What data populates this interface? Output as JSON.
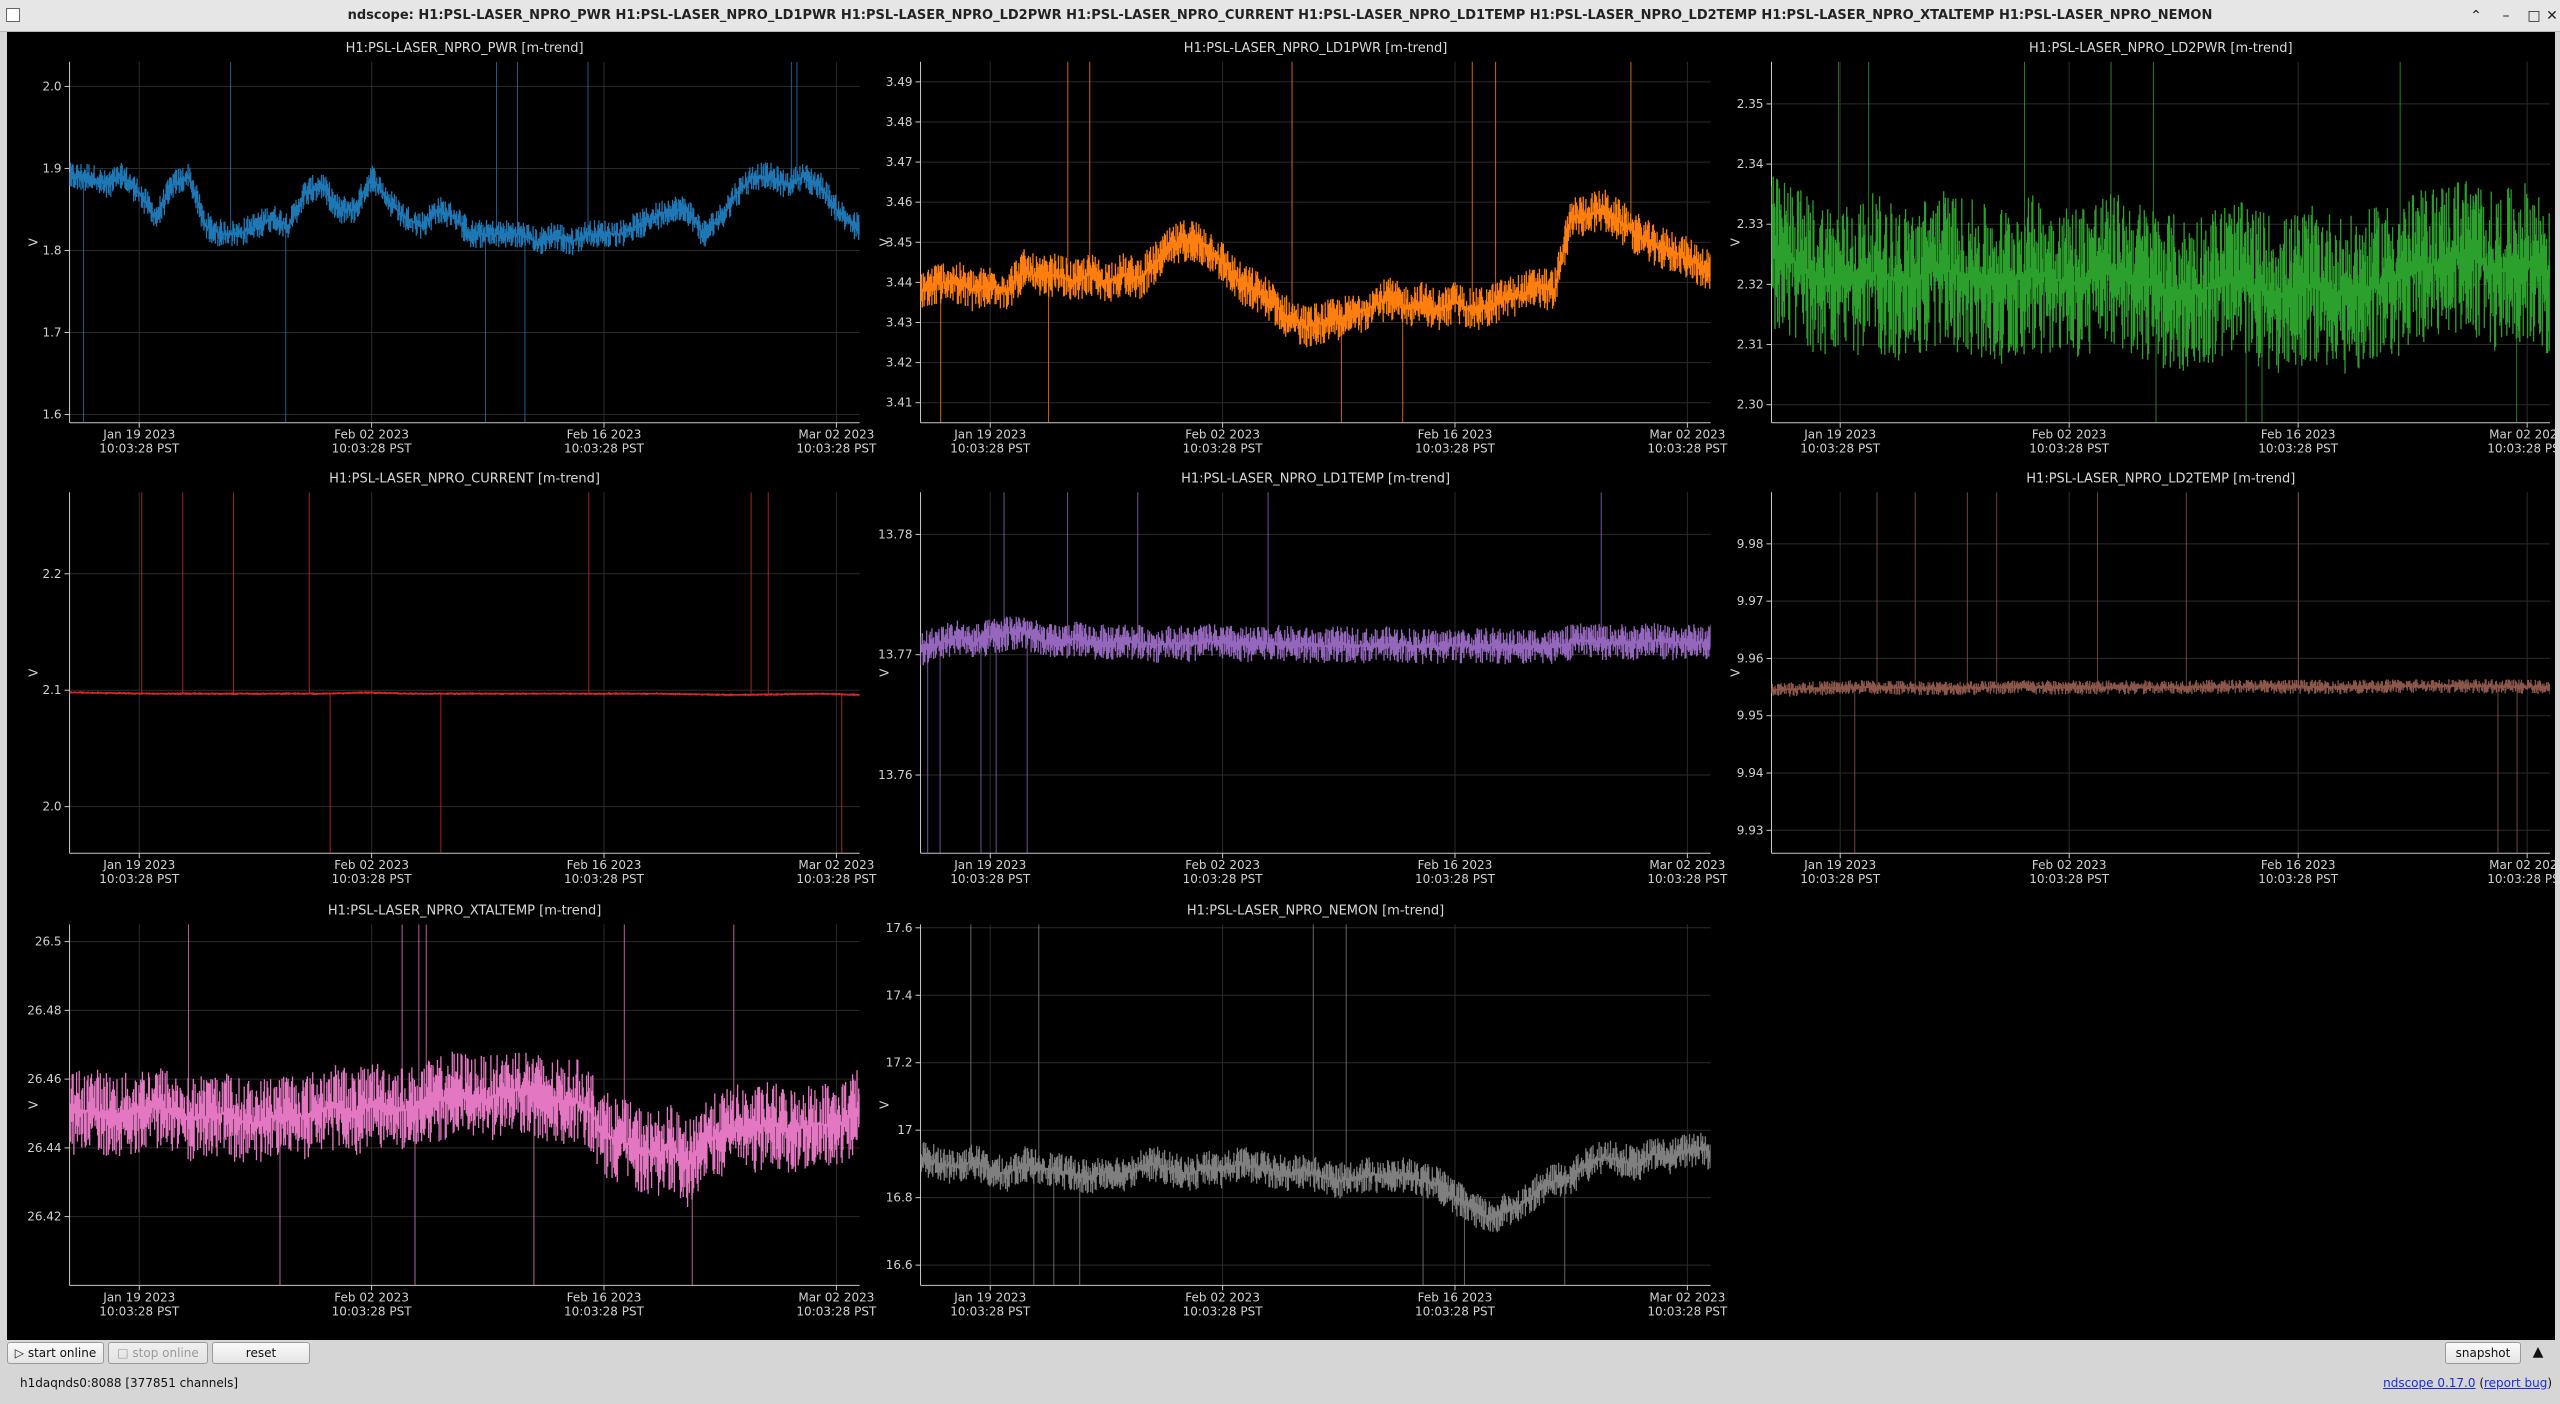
{
  "window": {
    "title": "ndscope: H1:PSL-LASER_NPRO_PWR H1:PSL-LASER_NPRO_LD1PWR H1:PSL-LASER_NPRO_LD2PWR H1:PSL-LASER_NPRO_CURRENT H1:PSL-LASER_NPRO_LD1TEMP H1:PSL-LASER_NPRO_LD2TEMP H1:PSL-LASER_NPRO_XTALTEMP H1:PSL-LASER_NPRO_NEMON"
  },
  "time_axis": {
    "ticks": [
      {
        "date": "Jan 19 2023",
        "time": "10:03:28 PST",
        "day": 19
      },
      {
        "date": "Feb 02 2023",
        "time": "10:03:28 PST",
        "day": 33
      },
      {
        "date": "Feb 16 2023",
        "time": "10:03:28 PST",
        "day": 47
      },
      {
        "date": "Mar 02 2023",
        "time": "10:03:28 PST",
        "day": 61
      }
    ],
    "range_days": [
      14.8,
      62.4
    ]
  },
  "chart_data": [
    {
      "type": "line",
      "title": "H1:PSL-LASER_NPRO_PWR [m-trend]",
      "ylabel": "V",
      "color": "#1f77b4",
      "ylim": [
        1.59,
        2.03
      ],
      "yticks": [
        "1.6",
        "1.7",
        "1.8",
        "1.9",
        "2.0"
      ],
      "ytickvals": [
        1.6,
        1.7,
        1.8,
        1.9,
        2.0
      ],
      "x": [
        14.8,
        16,
        17,
        18,
        19,
        20,
        21,
        22,
        23,
        24,
        25,
        26,
        27,
        28,
        29,
        30,
        31,
        32,
        33,
        34,
        35,
        36,
        37,
        38,
        39,
        40,
        41,
        42,
        43,
        44,
        45,
        46,
        47,
        48,
        49,
        50,
        51,
        52,
        53,
        54,
        55,
        56,
        57,
        58,
        59,
        60,
        61,
        62,
        62.4
      ],
      "values": [
        1.89,
        1.89,
        1.88,
        1.89,
        1.87,
        1.84,
        1.88,
        1.89,
        1.83,
        1.82,
        1.82,
        1.83,
        1.84,
        1.83,
        1.87,
        1.88,
        1.85,
        1.85,
        1.89,
        1.86,
        1.84,
        1.83,
        1.85,
        1.84,
        1.82,
        1.82,
        1.82,
        1.82,
        1.81,
        1.82,
        1.81,
        1.82,
        1.82,
        1.82,
        1.83,
        1.84,
        1.85,
        1.85,
        1.82,
        1.84,
        1.87,
        1.89,
        1.89,
        1.88,
        1.89,
        1.88,
        1.85,
        1.83,
        1.83
      ]
    },
    {
      "type": "line",
      "title": "H1:PSL-LASER_NPRO_LD1PWR [m-trend]",
      "ylabel": "V",
      "color": "#ff7f0e",
      "ylim": [
        3.405,
        3.495
      ],
      "yticks": [
        "3.41",
        "3.42",
        "3.43",
        "3.44",
        "3.45",
        "3.46",
        "3.47",
        "3.48",
        "3.49"
      ],
      "ytickvals": [
        3.41,
        3.42,
        3.43,
        3.44,
        3.45,
        3.46,
        3.47,
        3.48,
        3.49
      ],
      "x": [
        14.8,
        16,
        17,
        18,
        19,
        20,
        21,
        22,
        23,
        24,
        25,
        26,
        27,
        28,
        29,
        30,
        31,
        32,
        33,
        34,
        35,
        36,
        37,
        38,
        39,
        40,
        41,
        42,
        43,
        44,
        45,
        46,
        47,
        48,
        49,
        50,
        51,
        52,
        53,
        54,
        55,
        56,
        57,
        58,
        59,
        60,
        61,
        62,
        62.4
      ],
      "values": [
        3.438,
        3.44,
        3.44,
        3.438,
        3.439,
        3.438,
        3.443,
        3.441,
        3.442,
        3.44,
        3.442,
        3.44,
        3.442,
        3.441,
        3.445,
        3.449,
        3.451,
        3.449,
        3.445,
        3.44,
        3.438,
        3.435,
        3.431,
        3.429,
        3.43,
        3.431,
        3.432,
        3.434,
        3.436,
        3.434,
        3.435,
        3.433,
        3.435,
        3.433,
        3.434,
        3.436,
        3.437,
        3.439,
        3.438,
        3.456,
        3.457,
        3.458,
        3.455,
        3.452,
        3.449,
        3.448,
        3.446,
        3.444,
        3.443
      ]
    },
    {
      "type": "line",
      "title": "H1:PSL-LASER_NPRO_LD2PWR [m-trend]",
      "ylabel": "V",
      "color": "#2ca02c",
      "ylim": [
        2.297,
        2.357
      ],
      "yticks": [
        "2.30",
        "2.31",
        "2.32",
        "2.33",
        "2.34",
        "2.35"
      ],
      "ytickvals": [
        2.3,
        2.31,
        2.32,
        2.33,
        2.34,
        2.35
      ],
      "x": [
        14.8,
        16,
        17,
        18,
        19,
        20,
        21,
        22,
        23,
        24,
        25,
        26,
        27,
        28,
        29,
        30,
        31,
        32,
        33,
        34,
        35,
        36,
        37,
        38,
        39,
        40,
        41,
        42,
        43,
        44,
        45,
        46,
        47,
        48,
        49,
        50,
        51,
        52,
        53,
        54,
        55,
        56,
        57,
        58,
        59,
        60,
        61,
        62,
        62.4
      ],
      "values": [
        2.325,
        2.324,
        2.322,
        2.321,
        2.32,
        2.321,
        2.322,
        2.321,
        2.32,
        2.321,
        2.323,
        2.322,
        2.321,
        2.32,
        2.32,
        2.321,
        2.322,
        2.321,
        2.32,
        2.321,
        2.322,
        2.322,
        2.321,
        2.32,
        2.319,
        2.318,
        2.319,
        2.32,
        2.321,
        2.32,
        2.319,
        2.318,
        2.319,
        2.32,
        2.319,
        2.318,
        2.319,
        2.32,
        2.321,
        2.322,
        2.323,
        2.324,
        2.325,
        2.324,
        2.322,
        2.323,
        2.324,
        2.322,
        2.321
      ]
    },
    {
      "type": "line",
      "title": "H1:PSL-LASER_NPRO_CURRENT [m-trend]",
      "ylabel": "V",
      "color": "#d62728",
      "ylim": [
        1.96,
        2.27
      ],
      "yticks": [
        "2.0",
        "2.1",
        "2.2"
      ],
      "ytickvals": [
        2.0,
        2.1,
        2.2
      ],
      "x": [
        14.8,
        20,
        25,
        30,
        33,
        35,
        40,
        45,
        50,
        55,
        60,
        62.4
      ],
      "values": [
        2.098,
        2.097,
        2.097,
        2.097,
        2.098,
        2.097,
        2.097,
        2.097,
        2.097,
        2.096,
        2.097,
        2.096
      ]
    },
    {
      "type": "line",
      "title": "H1:PSL-LASER_NPRO_LD1TEMP [m-trend]",
      "ylabel": "V",
      "color": "#9467bd",
      "ylim": [
        13.7535,
        13.7835
      ],
      "yticks": [
        "13.76",
        "13.77",
        "13.78"
      ],
      "ytickvals": [
        13.76,
        13.77,
        13.78
      ],
      "x": [
        14.8,
        16,
        17,
        18,
        19,
        20,
        21,
        22,
        23,
        24,
        25,
        26,
        27,
        28,
        29,
        30,
        31,
        32,
        33,
        34,
        35,
        36,
        37,
        38,
        39,
        40,
        41,
        42,
        43,
        44,
        45,
        46,
        47,
        48,
        49,
        50,
        51,
        52,
        53,
        54,
        55,
        56,
        57,
        58,
        59,
        60,
        61,
        62,
        62.4
      ],
      "values": [
        13.7705,
        13.771,
        13.7715,
        13.771,
        13.7715,
        13.7718,
        13.772,
        13.7712,
        13.771,
        13.7713,
        13.7711,
        13.771,
        13.7712,
        13.771,
        13.7708,
        13.771,
        13.7709,
        13.7711,
        13.771,
        13.7709,
        13.7708,
        13.771,
        13.7709,
        13.7708,
        13.7707,
        13.7709,
        13.7708,
        13.7707,
        13.7709,
        13.7708,
        13.7707,
        13.7706,
        13.7708,
        13.7707,
        13.7708,
        13.7707,
        13.7706,
        13.7708,
        13.7706,
        13.771,
        13.7712,
        13.771,
        13.7711,
        13.771,
        13.7712,
        13.771,
        13.7711,
        13.771,
        13.7712
      ]
    },
    {
      "type": "line",
      "title": "H1:PSL-LASER_NPRO_LD2TEMP [m-trend]",
      "ylabel": "V",
      "color": "#8c564b",
      "ylim": [
        9.926,
        9.989
      ],
      "yticks": [
        "9.93",
        "9.94",
        "9.95",
        "9.96",
        "9.97",
        "9.98"
      ],
      "ytickvals": [
        9.93,
        9.94,
        9.95,
        9.96,
        9.97,
        9.98
      ],
      "x": [
        14.8,
        20,
        25,
        30,
        35,
        40,
        45,
        50,
        55,
        60,
        62.4
      ],
      "values": [
        9.9545,
        9.955,
        9.9548,
        9.955,
        9.9549,
        9.955,
        9.9551,
        9.955,
        9.9552,
        9.9551,
        9.955
      ]
    },
    {
      "type": "line",
      "title": "H1:PSL-LASER_NPRO_XTALTEMP [m-trend]",
      "ylabel": "V",
      "color": "#e377c2",
      "ylim": [
        26.4,
        26.505
      ],
      "yticks": [
        "26.42",
        "26.44",
        "26.46",
        "26.48",
        "26.5"
      ],
      "ytickvals": [
        26.42,
        26.44,
        26.46,
        26.48,
        26.5
      ],
      "x": [
        14.8,
        16,
        17,
        18,
        19,
        20,
        21,
        22,
        23,
        24,
        25,
        26,
        27,
        28,
        29,
        30,
        31,
        32,
        33,
        34,
        35,
        36,
        37,
        38,
        39,
        40,
        41,
        42,
        43,
        44,
        45,
        46,
        47,
        48,
        49,
        50,
        51,
        52,
        53,
        54,
        55,
        56,
        57,
        58,
        59,
        60,
        61,
        62,
        62.4
      ],
      "values": [
        26.45,
        26.451,
        26.45,
        26.449,
        26.451,
        26.452,
        26.45,
        26.448,
        26.449,
        26.45,
        26.448,
        26.447,
        26.449,
        26.45,
        26.449,
        26.451,
        26.452,
        26.45,
        26.453,
        26.452,
        26.451,
        26.452,
        26.454,
        26.456,
        26.455,
        26.454,
        26.456,
        26.457,
        26.455,
        26.453,
        26.454,
        26.452,
        26.444,
        26.442,
        26.44,
        26.438,
        26.44,
        26.435,
        26.442,
        26.444,
        26.446,
        26.445,
        26.447,
        26.445,
        26.446,
        26.447,
        26.446,
        26.45,
        26.452
      ]
    },
    {
      "type": "line",
      "title": "H1:PSL-LASER_NPRO_NEMON [m-trend]",
      "ylabel": "V",
      "color": "#7f7f7f",
      "ylim": [
        16.54,
        17.61
      ],
      "yticks": [
        "16.6",
        "16.8",
        "17",
        "17.2",
        "17.4",
        "17.6"
      ],
      "ytickvals": [
        16.6,
        16.8,
        17.0,
        17.2,
        17.4,
        17.6
      ],
      "x": [
        14.8,
        16,
        17,
        18,
        19,
        20,
        21,
        22,
        23,
        24,
        25,
        26,
        27,
        28,
        29,
        30,
        31,
        32,
        33,
        34,
        35,
        36,
        37,
        38,
        39,
        40,
        41,
        42,
        43,
        44,
        45,
        46,
        47,
        48,
        49,
        50,
        51,
        52,
        53,
        54,
        55,
        56,
        57,
        58,
        59,
        60,
        61,
        62,
        62.4
      ],
      "values": [
        16.92,
        16.9,
        16.89,
        16.91,
        16.88,
        16.87,
        16.9,
        16.89,
        16.88,
        16.87,
        16.86,
        16.88,
        16.87,
        16.89,
        16.9,
        16.88,
        16.87,
        16.89,
        16.88,
        16.9,
        16.89,
        16.88,
        16.87,
        16.88,
        16.86,
        16.85,
        16.86,
        16.87,
        16.86,
        16.87,
        16.85,
        16.84,
        16.8,
        16.77,
        16.74,
        16.76,
        16.78,
        16.82,
        16.85,
        16.86,
        16.9,
        16.92,
        16.91,
        16.9,
        16.93,
        16.92,
        16.94,
        16.95,
        16.92
      ]
    }
  ],
  "controls": {
    "start_online": "start online",
    "stop_online": "stop online",
    "reset": "reset",
    "snapshot": "snapshot"
  },
  "status": {
    "server": "h1daqnds0:8088  [377851 channels]",
    "version_link": "ndscope 0.17.0",
    "report_bug": "report bug"
  },
  "colors": {
    "background": "#000000",
    "grid": "#2a2a2a",
    "axis": "#c8c8c8"
  }
}
